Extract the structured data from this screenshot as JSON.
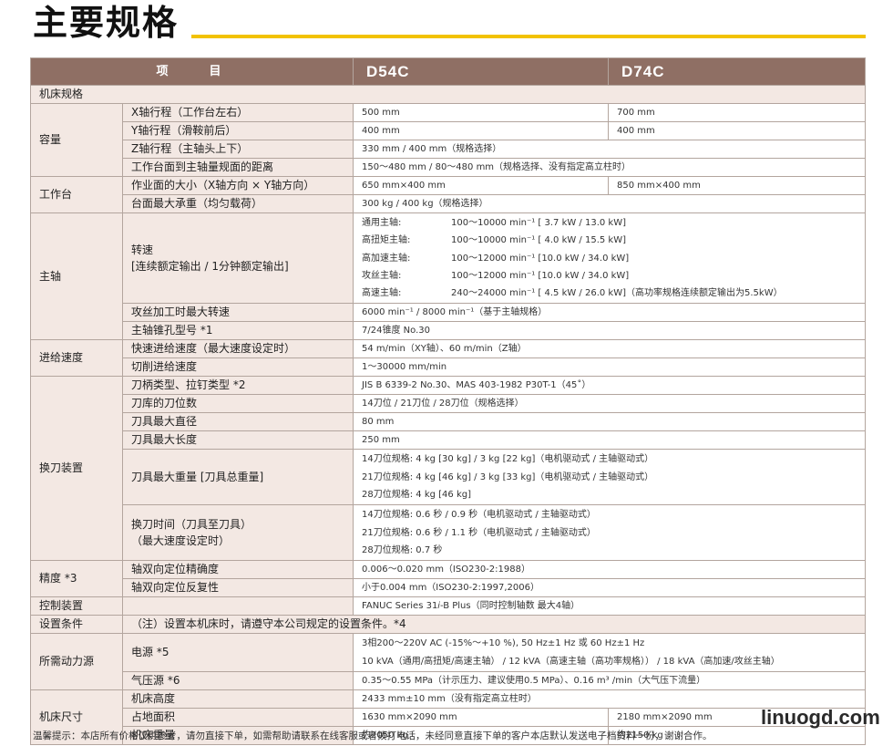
{
  "page_title": "主要规格",
  "header": {
    "item": "项　目",
    "model1": "D54C",
    "model2": "D74C"
  },
  "section_machine": "机床规格",
  "capacity": {
    "cat": "容量",
    "x_item": "X轴行程（工作台左右）",
    "x_v1": "500 mm",
    "x_v2": "700 mm",
    "y_item": "Y轴行程（滑鞍前后）",
    "y_v1": "400 mm",
    "y_v2": "400 mm",
    "z_item": "Z轴行程（主轴头上下）",
    "z_v": "330 mm / 400 mm（规格选择）",
    "d_item": "工作台面到主轴量规面的距离",
    "d_v": "150～480 mm / 80～480 mm（规格选择、没有指定高立柱时）"
  },
  "table": {
    "cat": "工作台",
    "size_item": "作业面的大小（X轴方向 × Y轴方向）",
    "size_v1": "650 mm×400 mm",
    "size_v2": "850 mm×400 mm",
    "load_item": "台面最大承重（均匀载荷）",
    "load_v": "300 kg / 400 kg（规格选择）"
  },
  "spindle": {
    "cat": "主轴",
    "speed_item_1": "转速",
    "speed_item_2": "[连续额定输出 / 1分钟额定输出]",
    "rows": [
      {
        "name": "通用主轴:",
        "value": "100～10000 min⁻¹ [  3.7 kW / 13.0 kW]"
      },
      {
        "name": "高扭矩主轴:",
        "value": "100～10000 min⁻¹ [  4.0 kW / 15.5 kW]"
      },
      {
        "name": "高加速主轴:",
        "value": "100～12000 min⁻¹ [10.0 kW / 34.0 kW]"
      },
      {
        "name": "攻丝主轴:",
        "value": "100～12000 min⁻¹ [10.0 kW / 34.0 kW]"
      },
      {
        "name": "高速主轴:",
        "value": "240～24000 min⁻¹ [  4.5 kW / 26.0 kW]（高功率规格连续额定输出为5.5kW）"
      }
    ],
    "tap_item": "攻丝加工时最大转速",
    "tap_v": "6000 min⁻¹ / 8000 min⁻¹（基于主轴规格）",
    "taper_item": "主轴锥孔型号 *1",
    "taper_v": "7/24锥度 No.30"
  },
  "feed": {
    "cat": "进给速度",
    "rapid_item": "快速进给速度（最大速度设定时）",
    "rapid_v": "54 m/min（XY轴）、60 m/min（Z轴）",
    "cut_item": "切削进给速度",
    "cut_v": "1～30000 mm/min"
  },
  "atc": {
    "cat": "换刀装置",
    "holder_item": "刀柄类型、拉钉类型 *2",
    "holder_v": "JIS B 6339-2 No.30、MAS 403-1982 P30T-1（45˚）",
    "tools_item": "刀库的刀位数",
    "tools_v": "14刀位 / 21刀位 / 28刀位（规格选择）",
    "dia_item": "刀具最大直径",
    "dia_v": "80 mm",
    "len_item": "刀具最大长度",
    "len_v": "250 mm",
    "wt_item": "刀具最大重量 [刀具总重量]",
    "wt_lines": [
      "14刀位规格: 4 kg [30 kg]  /  3 kg [22 kg]（电机驱动式 / 主轴驱动式）",
      "21刀位规格: 4 kg [46 kg]  /  3 kg [33 kg]（电机驱动式 / 主轴驱动式）",
      "28刀位规格: 4 kg [46 kg]"
    ],
    "time_item_1": "换刀时间（刀具至刀具）",
    "time_item_2": "（最大速度设定时）",
    "time_lines": [
      "14刀位规格: 0.6 秒  /  0.9 秒（电机驱动式 / 主轴驱动式）",
      "21刀位规格: 0.6 秒  /  1.1 秒（电机驱动式 / 主轴驱动式）",
      "28刀位规格: 0.7 秒"
    ]
  },
  "accuracy": {
    "cat": "精度  *3",
    "pos_item": "轴双向定位精确度",
    "pos_v": "0.006～0.020 mm（ISO230-2:1988）",
    "rep_item": "轴双向定位反复性",
    "rep_v": "小于0.004 mm（ISO230-2:1997,2006）"
  },
  "control": {
    "cat": "控制装置",
    "v": "FANUC Series 31𝑖-B Plus（同时控制轴数 最大4轴）"
  },
  "install": {
    "cat": "设置条件",
    "v": "（注）设置本机床时，请遵守本公司规定的设置条件。*4"
  },
  "power": {
    "cat": "所需动力源",
    "elec_item": "电源  *5",
    "elec_lines": [
      "3相200～220V AC (-15%～+10 %), 50 Hz±1 Hz 或 60 Hz±1 Hz",
      "10 kVA（通用/高扭矩/高速主轴） / 12 kVA（高速主轴（高功率规格）） / 18 kVA（高加速/攻丝主轴）"
    ],
    "air_item": "气压源   *6",
    "air_v": "0.35～0.55 MPa（计示压力、建议使用0.5 MPa）、0.16 m³ /min（大气压下流量）"
  },
  "dims": {
    "cat": "机床尺寸",
    "h_item": "机床高度",
    "h_v": "2433 mm±10 mm（没有指定高立柱时）",
    "area_item": "占地面积",
    "area_v1": "1630 mm×2090 mm",
    "area_v2": "2180 mm×2090 mm",
    "wt_item": "机床重量",
    "wt_v1": "约2050 kg",
    "wt_v2": "约2150 kg"
  },
  "footer": "温馨提示：本店所有价格仅供参考，请勿直接下单，如需帮助请联系在线客服或者拨打电话，未经同意直接下单的客户本店默认发送电子档资料一份，谢谢合作。",
  "watermark": "linuogd.com"
}
